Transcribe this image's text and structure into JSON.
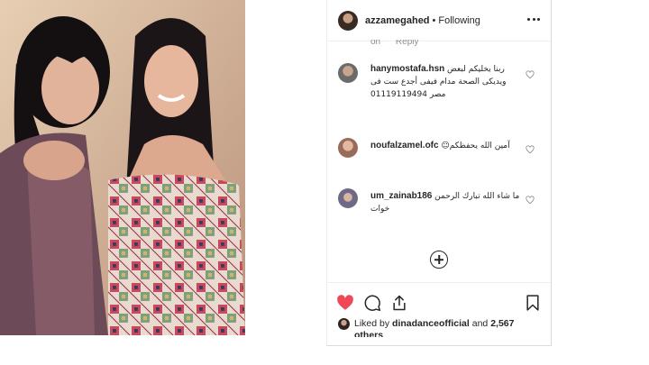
{
  "post": {
    "photo_alt": ""
  },
  "header": {
    "username": "azzamegahed",
    "dot": "•",
    "follow_status": "Following",
    "more_icon": "more-horizontal-icon"
  },
  "clipped_line": {
    "prefix": "on",
    "reply": "Reply"
  },
  "comments": [
    {
      "username": "hanymostafa.hsn",
      "text": "ربنا يخليكم لبعض ويديكى الصحة مدام فيفى أجدع ست فى مصر 01119119494",
      "avatar_color": "#8d8d8d"
    },
    {
      "username": "noufalzamel.ofc",
      "text": "☺آمين الله يحفظكم",
      "avatar_color": "#b07a6a"
    },
    {
      "username": "um_zainab186",
      "text": "ما شاء الله تبارك الرحمن خوات",
      "avatar_color": "#8a7fa0"
    }
  ],
  "actions": {
    "like_icon": "heart-filled-icon",
    "comment_icon": "comment-bubble-icon",
    "share_icon": "share-arrow-icon",
    "save_icon": "bookmark-icon",
    "like_color": "#ed4956"
  },
  "likes": {
    "prefix": "Liked by",
    "user": "dinadanceofficial",
    "and": "and",
    "count_text": "2,567 others"
  },
  "load_more_icon": "add-circle-icon"
}
